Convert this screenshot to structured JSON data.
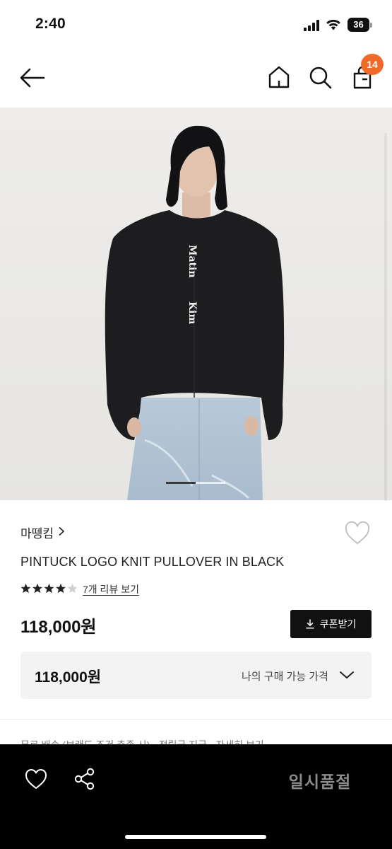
{
  "status_bar": {
    "time": "2:40",
    "battery_level": "36",
    "icons": [
      "signal-icon",
      "wifi-icon",
      "battery-icon"
    ]
  },
  "header": {
    "icons": [
      "back-arrow-icon",
      "home-icon",
      "search-icon",
      "shopping-bag-icon"
    ],
    "cart_count": "14",
    "badge_color": "#f06a2a"
  },
  "gallery": {
    "image_count": 2,
    "active_index": 1,
    "print_text": [
      "Matin",
      "Kim"
    ]
  },
  "product": {
    "brand": "마뗑킴",
    "title": "PINTUCK LOGO KNIT PULLOVER IN BLACK",
    "rating": 4.5,
    "rating_max": 5,
    "review_link": "7개 리뷰 보기",
    "price": "118,000원",
    "coupon_button": "쿠폰받기"
  },
  "price_summary": {
    "price": "118,000원",
    "label": "나의 구매 가능 가격"
  },
  "peek": {
    "text": "무료 배송 (브랜드 조건 충족 시) · 적립금 지급 · 자세히 보기"
  },
  "bottom_bar": {
    "icons": [
      "heart-icon",
      "share-icon"
    ],
    "status_button": "일시품절"
  },
  "colors": {
    "primary": "#111111",
    "badge": "#f06a2a",
    "soldout_text": "#8b8b8b",
    "price_box_bg": "#f3f3f3"
  }
}
